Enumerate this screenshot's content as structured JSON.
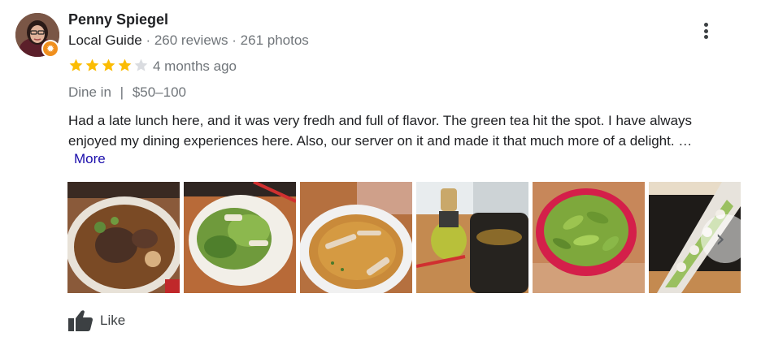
{
  "reviewer": {
    "name": "Penny Spiegel",
    "guide_label": "Local Guide",
    "sep1": " · ",
    "reviews": "260 reviews",
    "sep2": " · ",
    "photos": "261 photos",
    "badge_icon": "✹"
  },
  "rating": {
    "stars": 4,
    "max": 5,
    "filled_color": "#fbbc04",
    "empty_color": "#dadce0"
  },
  "date": "4 months ago",
  "dining": {
    "mode": "Dine in",
    "separator": "|",
    "price": "$50–100"
  },
  "review_text": "Had a late lunch here, and it was very fredh and full of flavor. The green tea hit the spot. I have always enjoyed my dining experiences here. Also, our server on it and made it that much more of a delight. …",
  "more_label": "More",
  "photos": [
    {
      "subject": "ramen-bowl"
    },
    {
      "subject": "salad"
    },
    {
      "subject": "miso-soup"
    },
    {
      "subject": "green-tea"
    },
    {
      "subject": "edamame"
    },
    {
      "subject": "sushi-roll"
    }
  ],
  "like_label": "Like",
  "colors": {
    "link": "#1a0dab",
    "secondary_text": "#70757a",
    "badge": "#f08f1d"
  }
}
